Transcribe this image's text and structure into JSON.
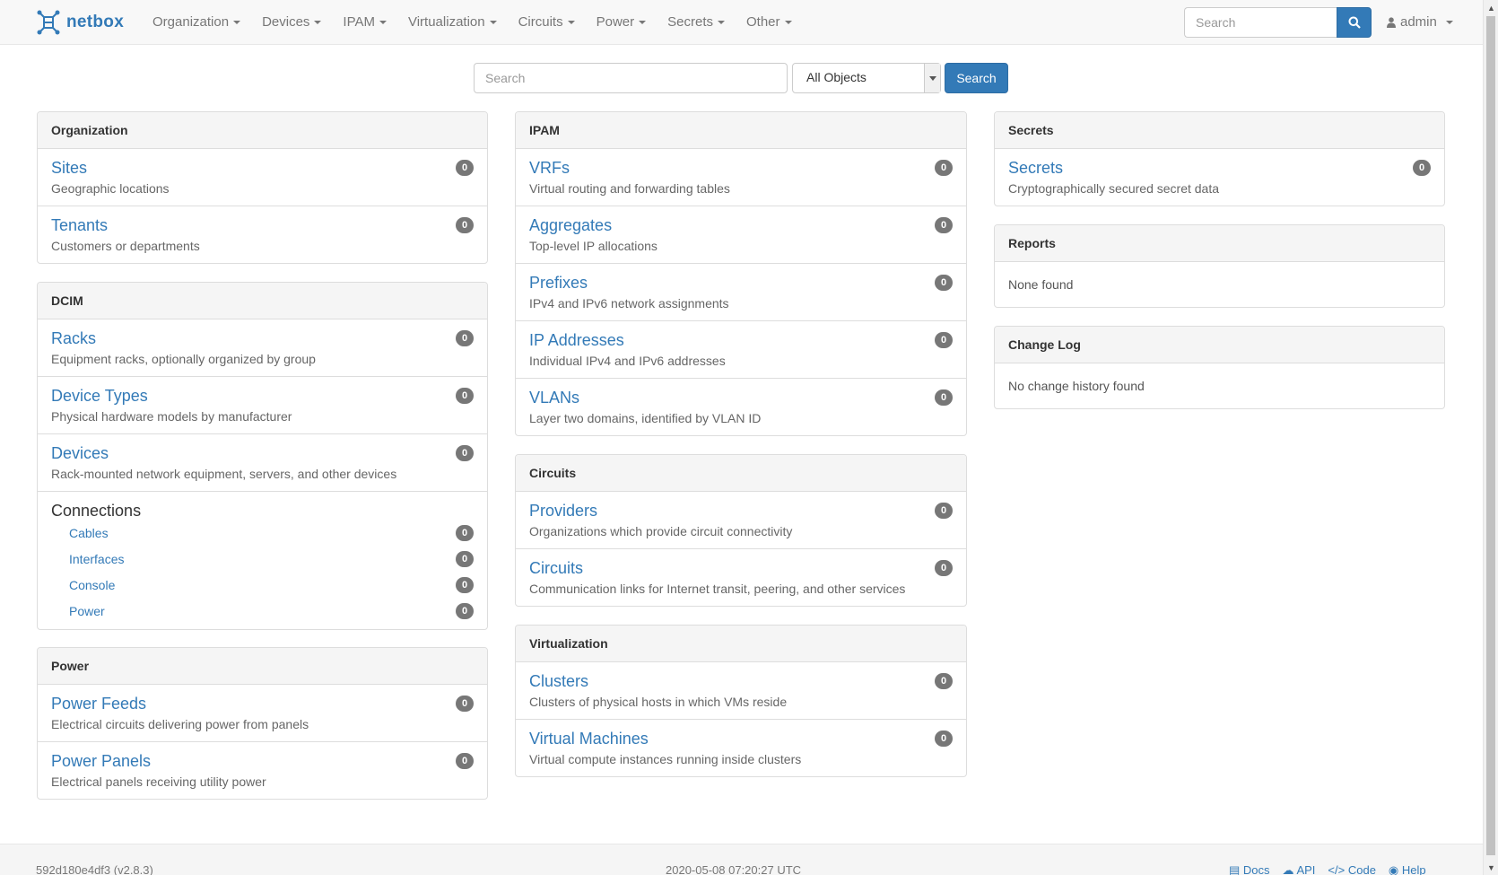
{
  "brand": {
    "name": "netbox"
  },
  "nav": {
    "items": [
      "Organization",
      "Devices",
      "IPAM",
      "Virtualization",
      "Circuits",
      "Power",
      "Secrets",
      "Other"
    ],
    "search_placeholder": "Search",
    "user": "admin"
  },
  "main_search": {
    "placeholder": "Search",
    "select_value": "All Objects",
    "button_label": "Search"
  },
  "panels": {
    "organization": {
      "heading": "Organization",
      "items": [
        {
          "title": "Sites",
          "desc": "Geographic locations",
          "count": "0"
        },
        {
          "title": "Tenants",
          "desc": "Customers or departments",
          "count": "0"
        }
      ]
    },
    "dcim": {
      "heading": "DCIM",
      "items": [
        {
          "title": "Racks",
          "desc": "Equipment racks, optionally organized by group",
          "count": "0"
        },
        {
          "title": "Device Types",
          "desc": "Physical hardware models by manufacturer",
          "count": "0"
        },
        {
          "title": "Devices",
          "desc": "Rack-mounted network equipment, servers, and other devices",
          "count": "0"
        }
      ],
      "connections": {
        "title": "Connections",
        "items": [
          {
            "title": "Cables",
            "count": "0"
          },
          {
            "title": "Interfaces",
            "count": "0"
          },
          {
            "title": "Console",
            "count": "0"
          },
          {
            "title": "Power",
            "count": "0"
          }
        ]
      }
    },
    "power": {
      "heading": "Power",
      "items": [
        {
          "title": "Power Feeds",
          "desc": "Electrical circuits delivering power from panels",
          "count": "0"
        },
        {
          "title": "Power Panels",
          "desc": "Electrical panels receiving utility power",
          "count": "0"
        }
      ]
    },
    "ipam": {
      "heading": "IPAM",
      "items": [
        {
          "title": "VRFs",
          "desc": "Virtual routing and forwarding tables",
          "count": "0"
        },
        {
          "title": "Aggregates",
          "desc": "Top-level IP allocations",
          "count": "0"
        },
        {
          "title": "Prefixes",
          "desc": "IPv4 and IPv6 network assignments",
          "count": "0"
        },
        {
          "title": "IP Addresses",
          "desc": "Individual IPv4 and IPv6 addresses",
          "count": "0"
        },
        {
          "title": "VLANs",
          "desc": "Layer two domains, identified by VLAN ID",
          "count": "0"
        }
      ]
    },
    "circuits": {
      "heading": "Circuits",
      "items": [
        {
          "title": "Providers",
          "desc": "Organizations which provide circuit connectivity",
          "count": "0"
        },
        {
          "title": "Circuits",
          "desc": "Communication links for Internet transit, peering, and other services",
          "count": "0"
        }
      ]
    },
    "virtualization": {
      "heading": "Virtualization",
      "items": [
        {
          "title": "Clusters",
          "desc": "Clusters of physical hosts in which VMs reside",
          "count": "0"
        },
        {
          "title": "Virtual Machines",
          "desc": "Virtual compute instances running inside clusters",
          "count": "0"
        }
      ]
    },
    "secrets": {
      "heading": "Secrets",
      "items": [
        {
          "title": "Secrets",
          "desc": "Cryptographically secured secret data",
          "count": "0"
        }
      ]
    },
    "reports": {
      "heading": "Reports",
      "body": "None found"
    },
    "changelog": {
      "heading": "Change Log",
      "body": "No change history found"
    }
  },
  "footer": {
    "version": "592d180e4df3 (v2.8.3)",
    "timestamp": "2020-05-08 07:20:27 UTC",
    "links": [
      "Docs",
      "API",
      "Code",
      "Help"
    ]
  },
  "colors": {
    "primary": "#337ab7",
    "badge": "#777777",
    "navbar_bg": "#f8f8f8",
    "panel_heading_bg": "#f5f5f5"
  }
}
